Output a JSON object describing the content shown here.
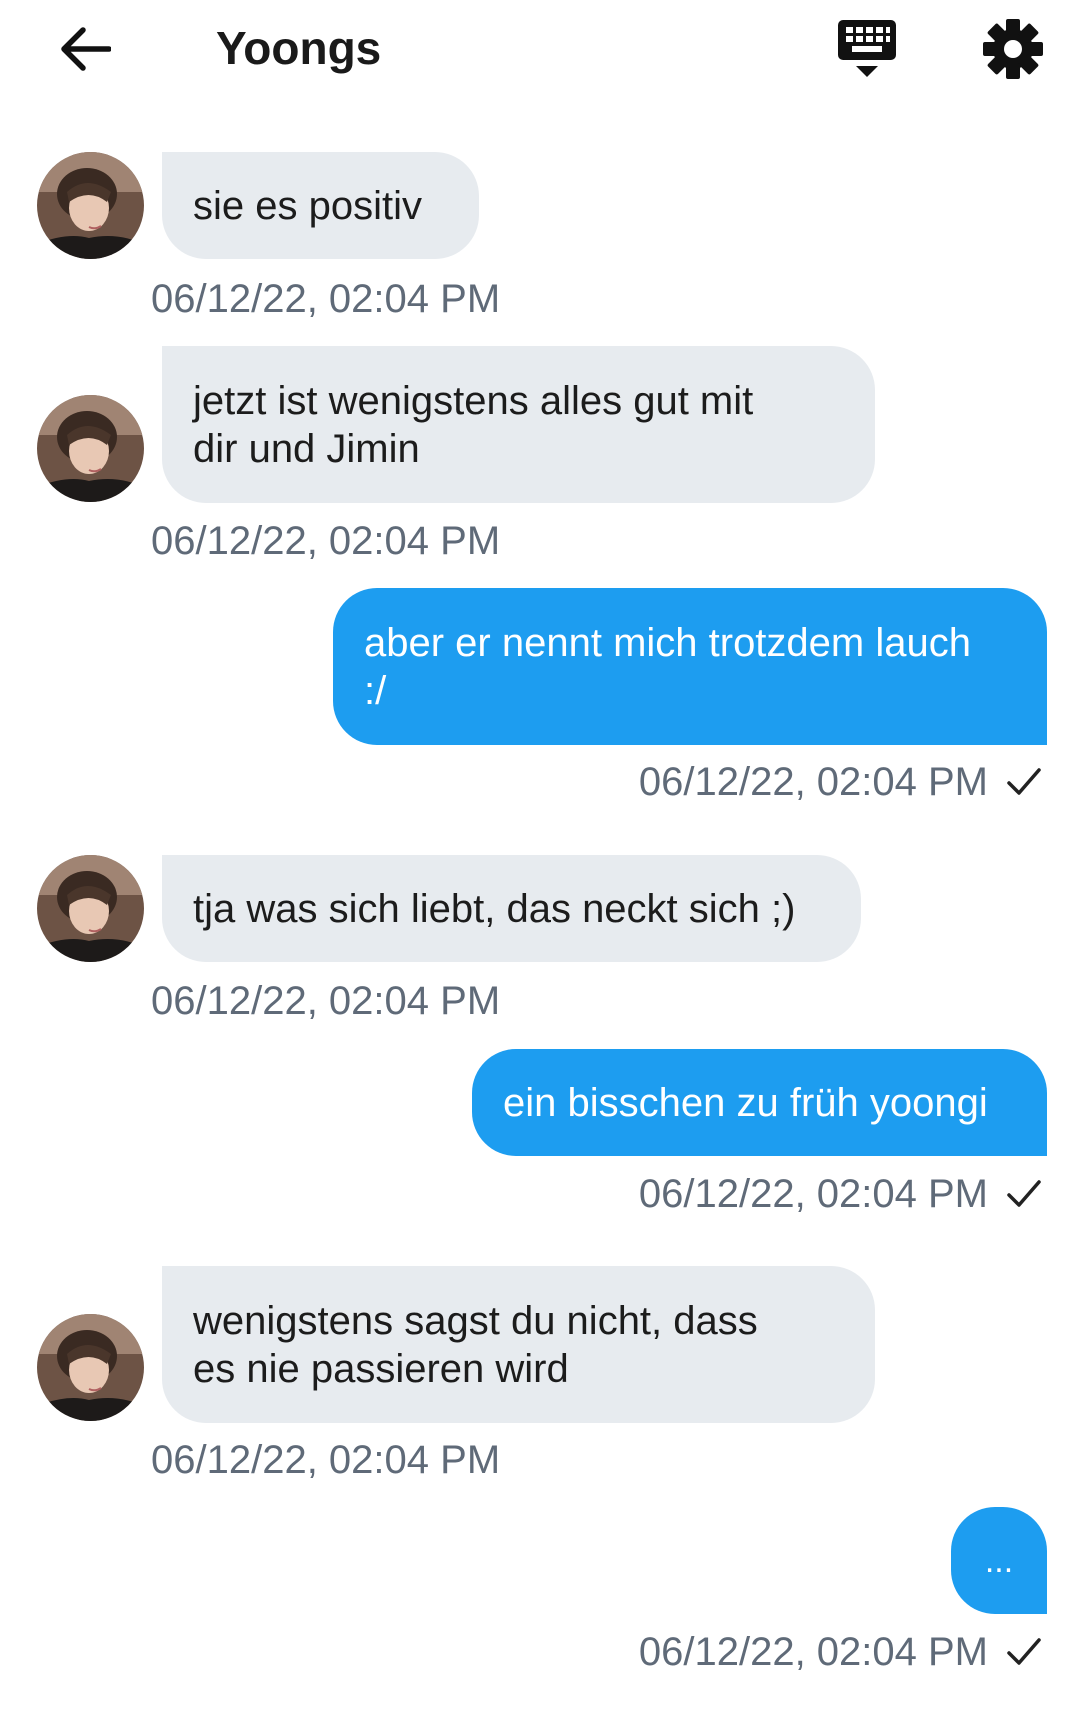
{
  "header": {
    "title": "Yoongs",
    "back_icon": "arrow-left-icon",
    "keyboard_icon": "keyboard-hide-icon",
    "settings_icon": "gear-icon"
  },
  "colors": {
    "incoming_bubble": "#e7ebef",
    "outgoing_bubble": "#1d9df0",
    "timestamp": "#5f6a78"
  },
  "messages": [
    {
      "direction": "in",
      "text": "sie es positiv",
      "time": "06/12/22, 02:04 PM"
    },
    {
      "direction": "in",
      "text": "jetzt ist wenigstens alles gut mit\ndir und Jimin",
      "time": "06/12/22, 02:04 PM"
    },
    {
      "direction": "out",
      "text": "aber er nennt mich trotzdem lauch\n:/",
      "time": "06/12/22, 02:04 PM",
      "status": "sent"
    },
    {
      "direction": "in",
      "text": "tja was sich liebt, das neckt sich ;)",
      "time": "06/12/22, 02:04 PM"
    },
    {
      "direction": "out",
      "text": "ein bisschen zu früh yoongi",
      "time": "06/12/22, 02:04 PM",
      "status": "sent"
    },
    {
      "direction": "in",
      "text": "wenigstens sagst du nicht, dass\nes nie passieren wird",
      "time": "06/12/22, 02:04 PM"
    },
    {
      "direction": "out",
      "text": "...",
      "time": "06/12/22, 02:04 PM",
      "status": "sent"
    }
  ]
}
